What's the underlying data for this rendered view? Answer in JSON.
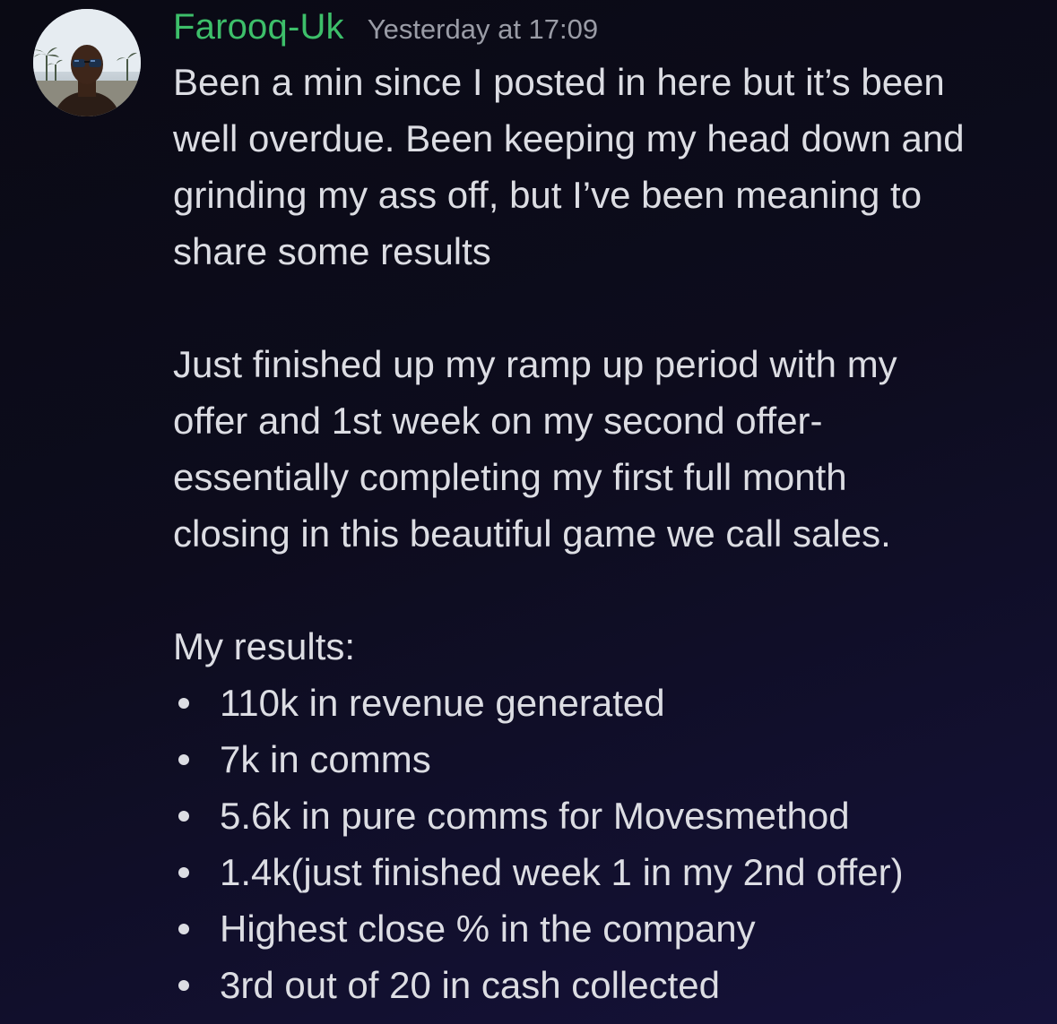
{
  "message": {
    "author": "Farooq-Uk",
    "timestamp": "Yesterday at 17:09",
    "author_color": "#3dbf6a",
    "avatar_icon": "user-avatar",
    "paragraph_1_lines": [
      "Been a min since I posted in here but it’s been",
      "well overdue. Been keeping my head down and",
      "grinding my ass off, but I’ve been meaning to",
      "share some results"
    ],
    "paragraph_2_lines": [
      "Just finished up my ramp up period with my",
      "offer and 1st week on my second offer-",
      "essentially completing my first full month",
      "closing in this beautiful game we call sales."
    ],
    "results_title": "My results:",
    "results": [
      "110k in revenue generated",
      "7k in comms",
      "5.6k in pure comms for Movesmethod",
      "1.4k(just finished week 1 in my 2nd offer)",
      "Highest close % in the company",
      "3rd out of 20 in cash collected"
    ]
  }
}
